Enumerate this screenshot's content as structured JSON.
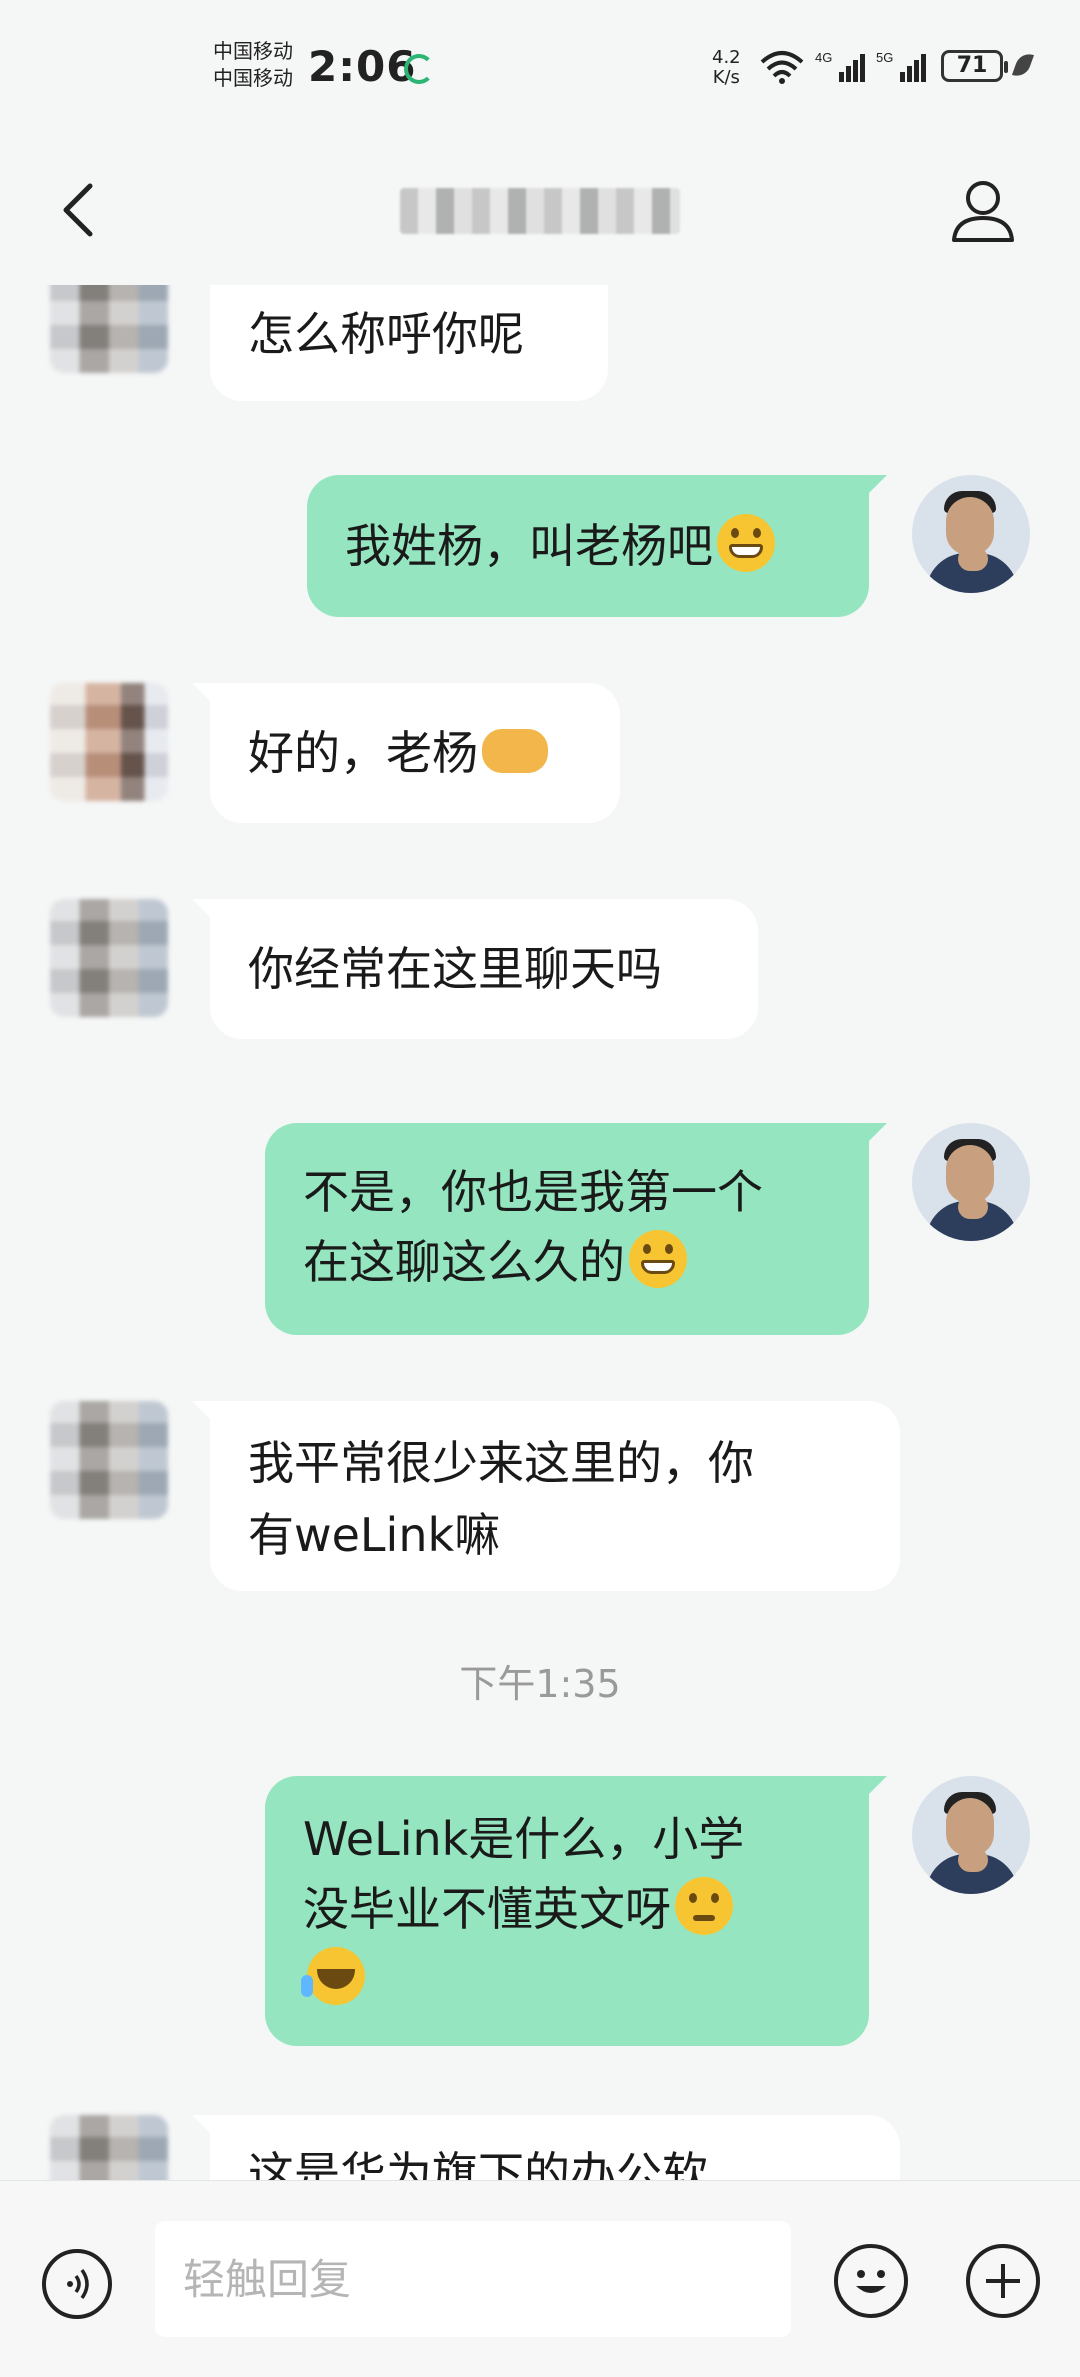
{
  "status_bar": {
    "carrier_1": "中国移动",
    "carrier_2": "中国移动",
    "time": "2:06",
    "net_speed_value": "4.2",
    "net_speed_unit": "K/s",
    "signal_1_label": "4G",
    "signal_2_label": "5G",
    "battery": "71"
  },
  "header": {
    "title": "",
    "back_icon": "chevron-left-icon",
    "profile_icon": "person-icon"
  },
  "messages": [
    {
      "side": "in",
      "text": "怎么称呼你呢"
    },
    {
      "side": "out",
      "text": "我姓杨，叫老杨吧",
      "emoji": "grinning-face"
    },
    {
      "side": "in",
      "text": "好的，老杨",
      "emoji": "handshake"
    },
    {
      "side": "in",
      "text": "你经常在这里聊天吗"
    },
    {
      "side": "out",
      "line1": "不是，你也是我第一个",
      "line2": "在这聊这么久的",
      "emoji": "grinning-face"
    },
    {
      "side": "in",
      "line1": "我平常很少来这里的，你",
      "line2": "有weLink嘛"
    },
    {
      "side": "time",
      "text": "下午1:35"
    },
    {
      "side": "out",
      "line1": "WeLink是什么，小学",
      "line2": "没毕业不懂英文呀",
      "emoji": "thinking-face",
      "emoji2": "crying-laughing-face"
    },
    {
      "side": "in",
      "text": "这是华为旗下的办公软"
    }
  ],
  "composer": {
    "placeholder": "轻触回复",
    "voice_icon": "voice-icon",
    "emoji_icon": "smiley-icon",
    "plus_icon": "plus-icon"
  }
}
